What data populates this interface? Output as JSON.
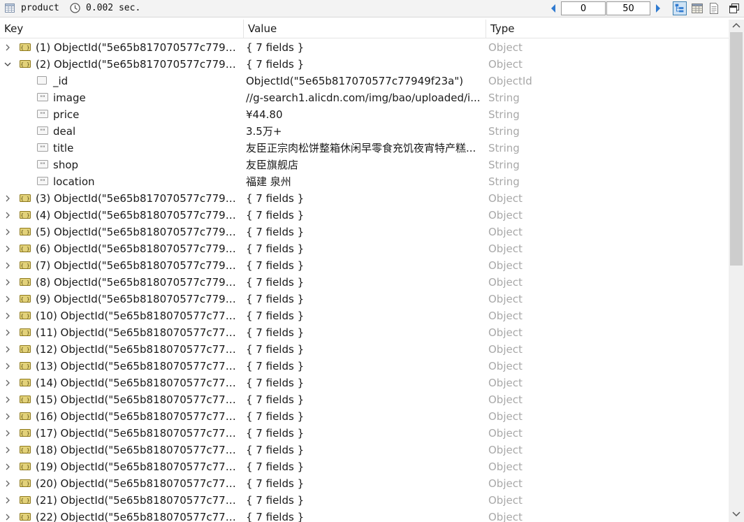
{
  "toolbar": {
    "collection": "product",
    "query_time": "0.002 sec.",
    "skip": "0",
    "limit": "50"
  },
  "columns": {
    "key": "Key",
    "value": "Value",
    "type": "Type"
  },
  "rows": [
    {
      "kind": "doc",
      "expanded": false,
      "key": "(1) ObjectId(\"5e65b817070577c77949...",
      "value": "{ 7 fields }",
      "type": "Object"
    },
    {
      "kind": "doc",
      "expanded": true,
      "key": "(2) ObjectId(\"5e65b817070577c77949...",
      "value": "{ 7 fields }",
      "type": "Object"
    },
    {
      "kind": "field",
      "icon": "id",
      "key": "_id",
      "value": "ObjectId(\"5e65b817070577c77949f23a\")",
      "type": "ObjectId"
    },
    {
      "kind": "field",
      "icon": "string",
      "key": "image",
      "value": "//g-search1.alicdn.com/img/bao/uploaded/i...",
      "type": "String"
    },
    {
      "kind": "field",
      "icon": "string",
      "key": "price",
      "value": "¥44.80",
      "type": "String"
    },
    {
      "kind": "field",
      "icon": "string",
      "key": "deal",
      "value": "3.5万+",
      "type": "String"
    },
    {
      "kind": "field",
      "icon": "string",
      "key": "title",
      "value": "友臣正宗肉松饼整箱休闲早零食充饥夜宵特产糕...",
      "type": "String"
    },
    {
      "kind": "field",
      "icon": "string",
      "key": "shop",
      "value": "友臣旗舰店",
      "type": "String"
    },
    {
      "kind": "field",
      "icon": "string",
      "key": "location",
      "value": "福建 泉州",
      "type": "String"
    },
    {
      "kind": "doc",
      "expanded": false,
      "key": "(3) ObjectId(\"5e65b817070577c77949...",
      "value": "{ 7 fields }",
      "type": "Object"
    },
    {
      "kind": "doc",
      "expanded": false,
      "key": "(4) ObjectId(\"5e65b818070577c77949...",
      "value": "{ 7 fields }",
      "type": "Object"
    },
    {
      "kind": "doc",
      "expanded": false,
      "key": "(5) ObjectId(\"5e65b818070577c77949...",
      "value": "{ 7 fields }",
      "type": "Object"
    },
    {
      "kind": "doc",
      "expanded": false,
      "key": "(6) ObjectId(\"5e65b818070577c77949...",
      "value": "{ 7 fields }",
      "type": "Object"
    },
    {
      "kind": "doc",
      "expanded": false,
      "key": "(7) ObjectId(\"5e65b818070577c77949...",
      "value": "{ 7 fields }",
      "type": "Object"
    },
    {
      "kind": "doc",
      "expanded": false,
      "key": "(8) ObjectId(\"5e65b818070577c77949...",
      "value": "{ 7 fields }",
      "type": "Object"
    },
    {
      "kind": "doc",
      "expanded": false,
      "key": "(9) ObjectId(\"5e65b818070577c77949...",
      "value": "{ 7 fields }",
      "type": "Object"
    },
    {
      "kind": "doc",
      "expanded": false,
      "key": "(10) ObjectId(\"5e65b818070577c7794...",
      "value": "{ 7 fields }",
      "type": "Object"
    },
    {
      "kind": "doc",
      "expanded": false,
      "key": "(11) ObjectId(\"5e65b818070577c7794...",
      "value": "{ 7 fields }",
      "type": "Object"
    },
    {
      "kind": "doc",
      "expanded": false,
      "key": "(12) ObjectId(\"5e65b818070577c7794...",
      "value": "{ 7 fields }",
      "type": "Object"
    },
    {
      "kind": "doc",
      "expanded": false,
      "key": "(13) ObjectId(\"5e65b818070577c7794...",
      "value": "{ 7 fields }",
      "type": "Object"
    },
    {
      "kind": "doc",
      "expanded": false,
      "key": "(14) ObjectId(\"5e65b818070577c7794...",
      "value": "{ 7 fields }",
      "type": "Object"
    },
    {
      "kind": "doc",
      "expanded": false,
      "key": "(15) ObjectId(\"5e65b818070577c7794...",
      "value": "{ 7 fields }",
      "type": "Object"
    },
    {
      "kind": "doc",
      "expanded": false,
      "key": "(16) ObjectId(\"5e65b818070577c7794...",
      "value": "{ 7 fields }",
      "type": "Object"
    },
    {
      "kind": "doc",
      "expanded": false,
      "key": "(17) ObjectId(\"5e65b818070577c7794...",
      "value": "{ 7 fields }",
      "type": "Object"
    },
    {
      "kind": "doc",
      "expanded": false,
      "key": "(18) ObjectId(\"5e65b818070577c7794...",
      "value": "{ 7 fields }",
      "type": "Object"
    },
    {
      "kind": "doc",
      "expanded": false,
      "key": "(19) ObjectId(\"5e65b818070577c7794...",
      "value": "{ 7 fields }",
      "type": "Object"
    },
    {
      "kind": "doc",
      "expanded": false,
      "key": "(20) ObjectId(\"5e65b818070577c7794...",
      "value": "{ 7 fields }",
      "type": "Object"
    },
    {
      "kind": "doc",
      "expanded": false,
      "key": "(21) ObjectId(\"5e65b818070577c7794...",
      "value": "{ 7 fields }",
      "type": "Object"
    },
    {
      "kind": "doc",
      "expanded": false,
      "key": "(22) ObjectId(\"5e65b818070577c7794...",
      "value": "{ 7 fields }",
      "type": "Object"
    }
  ],
  "colors": {
    "type_text": "#a8a8a8",
    "accent": "#2f7ad0"
  },
  "icons": {
    "toolbar": [
      "collection-icon",
      "clock-icon",
      "prev-page-icon",
      "next-page-icon",
      "tree-view-icon",
      "table-view-icon",
      "text-view-icon",
      "maximize-icon"
    ],
    "rows": [
      "expand-chevron-icon",
      "collapse-chevron-icon",
      "document-icon",
      "id-field-icon",
      "string-field-icon"
    ]
  }
}
